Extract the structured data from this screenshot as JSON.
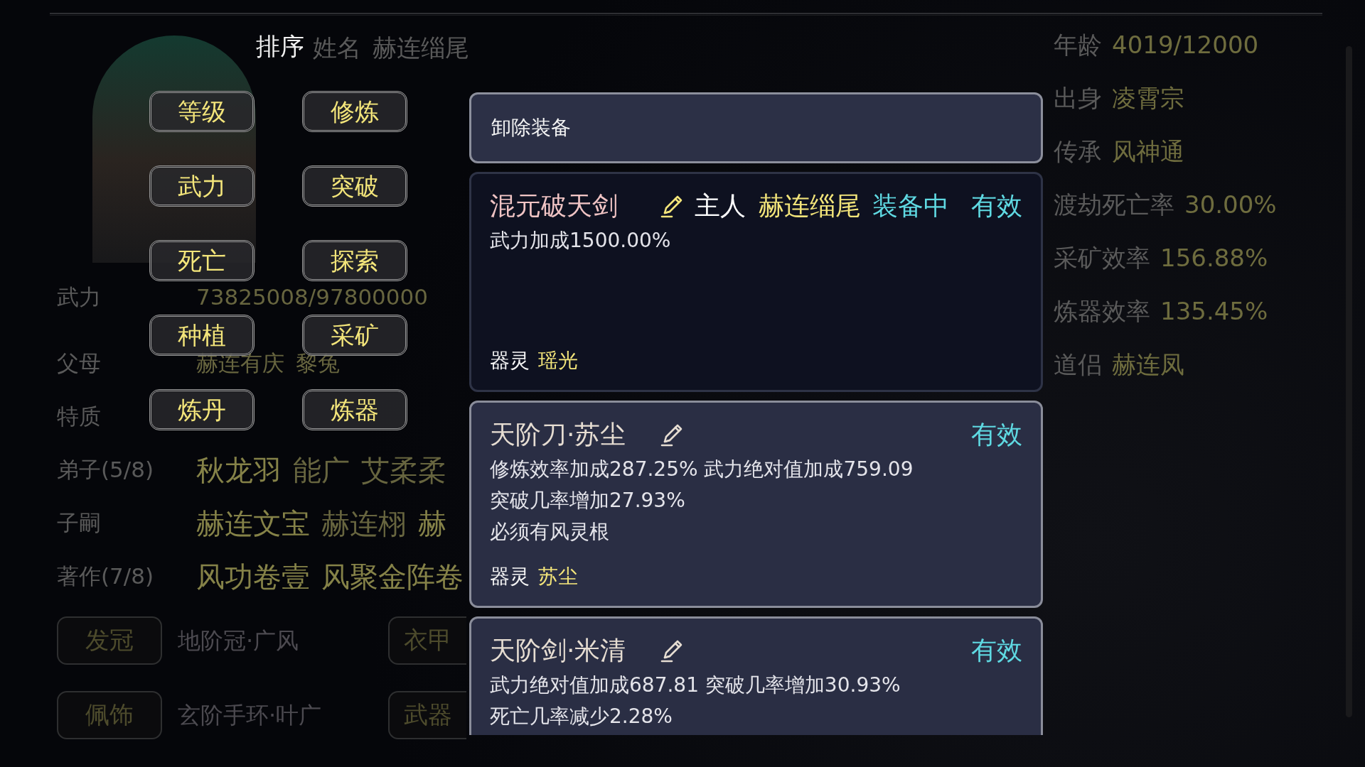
{
  "sort_menu": {
    "title": "排序",
    "options": [
      "等级",
      "修炼",
      "武力",
      "突破",
      "死亡",
      "探索",
      "种植",
      "采矿",
      "炼丹",
      "炼器"
    ]
  },
  "profile": {
    "name_label": "姓名",
    "name": "赫连缁尾",
    "rows": [
      {
        "kind": "stat",
        "label": "武力",
        "values": [
          {
            "text": "73825008/97800000",
            "highlighted": false
          }
        ]
      },
      {
        "kind": "stat",
        "label": "父母",
        "values": [
          {
            "text": "赫连有庆",
            "highlighted": false
          },
          {
            "text": "黎兔",
            "highlighted": false
          }
        ]
      },
      {
        "kind": "stat",
        "label": "特质"
      },
      {
        "kind": "list",
        "label": "弟子(5/8)",
        "values": [
          {
            "text": "秋龙羽",
            "highlighted": true
          },
          {
            "text": "能广",
            "highlighted": false
          },
          {
            "text": "艾柔柔",
            "highlighted": false
          }
        ]
      },
      {
        "kind": "list",
        "label": "子嗣",
        "values": [
          {
            "text": "赫连文宝",
            "highlighted": true
          },
          {
            "text": "赫连栩",
            "highlighted": false
          },
          {
            "text": "赫",
            "highlighted": true
          }
        ]
      },
      {
        "kind": "list",
        "label": "著作(7/8)",
        "values": [
          {
            "text": "风功卷壹",
            "highlighted": true
          },
          {
            "text": "风聚金阵卷",
            "highlighted": true
          }
        ]
      }
    ],
    "slots": [
      {
        "slot": "发冠",
        "item": "地阶冠·广风"
      },
      {
        "slot": "衣甲"
      },
      {
        "slot": "佩饰",
        "item": "玄阶手环·叶广"
      },
      {
        "slot": "武器"
      }
    ]
  },
  "attributes": [
    {
      "label": "年龄",
      "value": "4019/12000"
    },
    {
      "label": "出身",
      "value": "凌霄宗"
    },
    {
      "label": "传承",
      "value": "风神通"
    },
    {
      "label": "渡劫死亡率",
      "value": "30.00%"
    },
    {
      "label": "采矿效率",
      "value": "156.88%"
    },
    {
      "label": "炼器效率",
      "value": "135.45%"
    },
    {
      "label": "道侣",
      "value": "赫连凤"
    }
  ],
  "popup": {
    "unequip": "卸除装备",
    "items": [
      {
        "name": "混元破天剑",
        "color": "#f0c4c4",
        "equipped": true,
        "owner_label": "主人",
        "owner": "赫连缁尾",
        "equip_status": "装备中",
        "validity": "有效",
        "stats": [
          "武力加成1500.00%"
        ],
        "spirit_label": "器灵",
        "spirit": "瑶光"
      },
      {
        "name": "天阶刀·苏尘",
        "color": "#e6ddd2",
        "equipped": false,
        "validity": "有效",
        "stats": [
          "修炼效率加成287.25% 武力绝对值加成759.09",
          "突破几率增加27.93%",
          "必须有风灵根"
        ],
        "spirit_label": "器灵",
        "spirit": "苏尘"
      },
      {
        "name": "天阶剑·米清",
        "color": "#e6ddd2",
        "equipped": false,
        "validity": "有效",
        "stats": [
          "武力绝对值加成687.81 突破几率增加30.93%",
          "死亡几率减少2.28%"
        ]
      }
    ]
  }
}
